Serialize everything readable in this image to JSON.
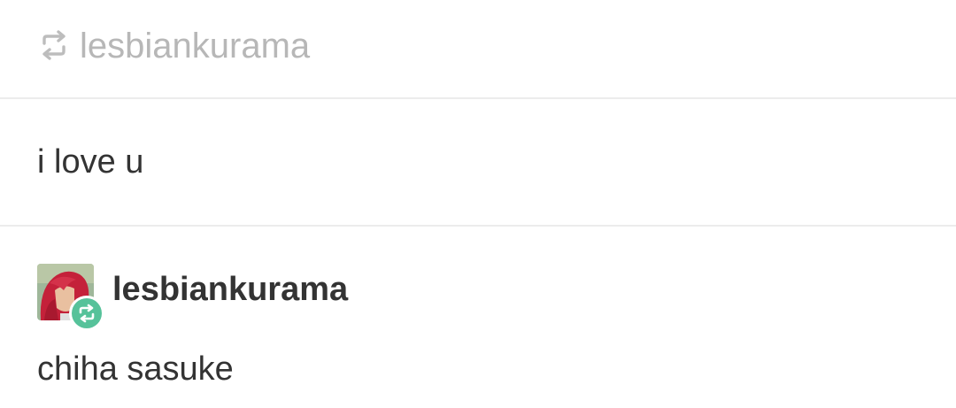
{
  "reblog_header": {
    "icon": "reblog-icon",
    "username": "lesbiankurama"
  },
  "message": {
    "text": "i love u"
  },
  "post": {
    "avatar_icon": "avatar-image",
    "badge_icon": "reblog-badge-icon",
    "badge_color": "#56c29a",
    "username": "lesbiankurama",
    "body": "chiha sasuke"
  }
}
